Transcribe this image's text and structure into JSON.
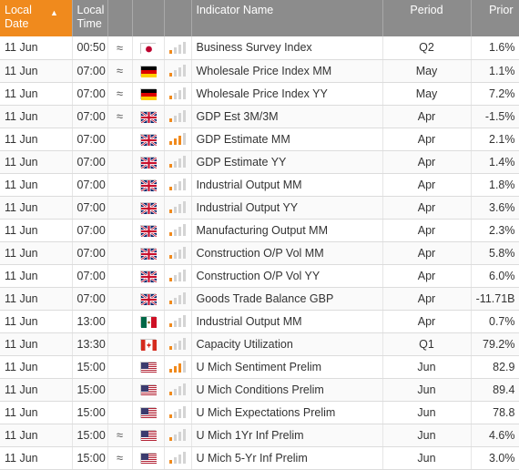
{
  "header": {
    "local_date": "Local Date",
    "local_time": "Local Time",
    "sort_icon": "triangle-up-icon",
    "indicator_name": "Indicator Name",
    "period": "Period",
    "prior": "Prior"
  },
  "colors": {
    "header_bg": "#8c8c8c",
    "sorted_header_bg": "#f08a1d",
    "volatility_on": "#f08a1d",
    "volatility_off": "#d4d4d4"
  },
  "rows": [
    {
      "date": "11 Jun",
      "time": "00:50",
      "approx": "≈",
      "flag": "jp",
      "volatility": 1,
      "name": "Business Survey Index",
      "period": "Q2",
      "prior": "1.6%"
    },
    {
      "date": "11 Jun",
      "time": "07:00",
      "approx": "≈",
      "flag": "de",
      "volatility": 1,
      "name": "Wholesale Price Index MM",
      "period": "May",
      "prior": "1.1%"
    },
    {
      "date": "11 Jun",
      "time": "07:00",
      "approx": "≈",
      "flag": "de",
      "volatility": 1,
      "name": "Wholesale Price Index YY",
      "period": "May",
      "prior": "7.2%"
    },
    {
      "date": "11 Jun",
      "time": "07:00",
      "approx": "≈",
      "flag": "gb",
      "volatility": 1,
      "name": "GDP Est 3M/3M",
      "period": "Apr",
      "prior": "-1.5%"
    },
    {
      "date": "11 Jun",
      "time": "07:00",
      "approx": "",
      "flag": "gb",
      "volatility": 3,
      "name": "GDP Estimate MM",
      "period": "Apr",
      "prior": "2.1%"
    },
    {
      "date": "11 Jun",
      "time": "07:00",
      "approx": "",
      "flag": "gb",
      "volatility": 1,
      "name": "GDP Estimate YY",
      "period": "Apr",
      "prior": "1.4%"
    },
    {
      "date": "11 Jun",
      "time": "07:00",
      "approx": "",
      "flag": "gb",
      "volatility": 1,
      "name": "Industrial Output MM",
      "period": "Apr",
      "prior": "1.8%"
    },
    {
      "date": "11 Jun",
      "time": "07:00",
      "approx": "",
      "flag": "gb",
      "volatility": 1,
      "name": "Industrial Output YY",
      "period": "Apr",
      "prior": "3.6%"
    },
    {
      "date": "11 Jun",
      "time": "07:00",
      "approx": "",
      "flag": "gb",
      "volatility": 1,
      "name": "Manufacturing Output MM",
      "period": "Apr",
      "prior": "2.3%"
    },
    {
      "date": "11 Jun",
      "time": "07:00",
      "approx": "",
      "flag": "gb",
      "volatility": 1,
      "name": "Construction O/P Vol MM",
      "period": "Apr",
      "prior": "5.8%"
    },
    {
      "date": "11 Jun",
      "time": "07:00",
      "approx": "",
      "flag": "gb",
      "volatility": 1,
      "name": "Construction O/P Vol YY",
      "period": "Apr",
      "prior": "6.0%"
    },
    {
      "date": "11 Jun",
      "time": "07:00",
      "approx": "",
      "flag": "gb",
      "volatility": 1,
      "name": "Goods Trade Balance GBP",
      "period": "Apr",
      "prior": "-11.71B"
    },
    {
      "date": "11 Jun",
      "time": "13:00",
      "approx": "",
      "flag": "mx",
      "volatility": 1,
      "name": "Industrial Output MM",
      "period": "Apr",
      "prior": "0.7%"
    },
    {
      "date": "11 Jun",
      "time": "13:30",
      "approx": "",
      "flag": "ca",
      "volatility": 1,
      "name": "Capacity Utilization",
      "period": "Q1",
      "prior": "79.2%"
    },
    {
      "date": "11 Jun",
      "time": "15:00",
      "approx": "",
      "flag": "us",
      "volatility": 3,
      "name": "U Mich Sentiment Prelim",
      "period": "Jun",
      "prior": "82.9"
    },
    {
      "date": "11 Jun",
      "time": "15:00",
      "approx": "",
      "flag": "us",
      "volatility": 1,
      "name": "U Mich Conditions Prelim",
      "period": "Jun",
      "prior": "89.4"
    },
    {
      "date": "11 Jun",
      "time": "15:00",
      "approx": "",
      "flag": "us",
      "volatility": 1,
      "name": "U Mich Expectations Prelim",
      "period": "Jun",
      "prior": "78.8"
    },
    {
      "date": "11 Jun",
      "time": "15:00",
      "approx": "≈",
      "flag": "us",
      "volatility": 1,
      "name": "U Mich 1Yr Inf Prelim",
      "period": "Jun",
      "prior": "4.6%"
    },
    {
      "date": "11 Jun",
      "time": "15:00",
      "approx": "≈",
      "flag": "us",
      "volatility": 1,
      "name": "U Mich 5-Yr Inf Prelim",
      "period": "Jun",
      "prior": "3.0%"
    }
  ]
}
